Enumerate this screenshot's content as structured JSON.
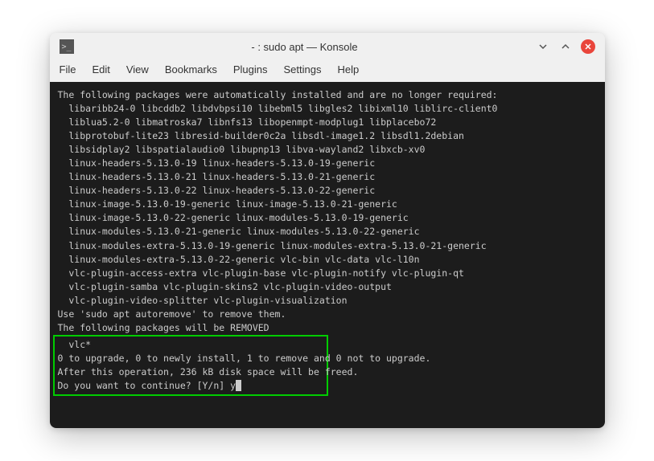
{
  "window": {
    "title": "- : sudo apt — Konsole"
  },
  "menubar": {
    "file": "File",
    "edit": "Edit",
    "view": "View",
    "bookmarks": "Bookmarks",
    "plugins": "Plugins",
    "settings": "Settings",
    "help": "Help"
  },
  "terminal": {
    "line1": "The following packages were automatically installed and are no longer required:",
    "line2": "  libaribb24-0 libcddb2 libdvbpsi10 libebml5 libgles2 libixml10 liblirc-client0",
    "line3": "  liblua5.2-0 libmatroska7 libnfs13 libopenmpt-modplug1 libplacebo72",
    "line4": "  libprotobuf-lite23 libresid-builder0c2a libsdl-image1.2 libsdl1.2debian",
    "line5": "  libsidplay2 libspatialaudio0 libupnp13 libva-wayland2 libxcb-xv0",
    "line6": "  linux-headers-5.13.0-19 linux-headers-5.13.0-19-generic",
    "line7": "  linux-headers-5.13.0-21 linux-headers-5.13.0-21-generic",
    "line8": "  linux-headers-5.13.0-22 linux-headers-5.13.0-22-generic",
    "line9": "  linux-image-5.13.0-19-generic linux-image-5.13.0-21-generic",
    "line10": "  linux-image-5.13.0-22-generic linux-modules-5.13.0-19-generic",
    "line11": "  linux-modules-5.13.0-21-generic linux-modules-5.13.0-22-generic",
    "line12": "  linux-modules-extra-5.13.0-19-generic linux-modules-extra-5.13.0-21-generic",
    "line13": "  linux-modules-extra-5.13.0-22-generic vlc-bin vlc-data vlc-l10n",
    "line14": "  vlc-plugin-access-extra vlc-plugin-base vlc-plugin-notify vlc-plugin-qt",
    "line15": "  vlc-plugin-samba vlc-plugin-skins2 vlc-plugin-video-output",
    "line16": "  vlc-plugin-video-splitter vlc-plugin-visualization",
    "line17": "Use 'sudo apt autoremove' to remove them.",
    "line18": "The following packages will be REMOVED",
    "line19": "  vlc*",
    "line20": "0 to upgrade, 0 to newly install, 1 to remove and 0 not to upgrade.",
    "line21": "After this operation, 236 kB disk space will be freed.",
    "line22": "Do you want to continue? [Y/n] y"
  }
}
